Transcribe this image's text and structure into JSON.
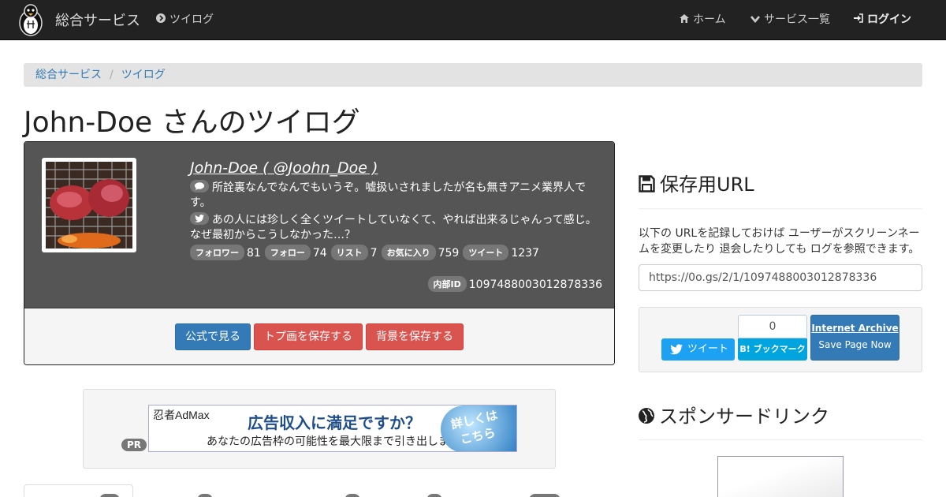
{
  "navbar": {
    "brand": "総合サービス",
    "tweet_log_link": "ツイログ",
    "home_link": "ホーム",
    "services_link": "サービス一覧",
    "login_link": "ログイン"
  },
  "breadcrumb": {
    "root": "総合サービス",
    "current": "ツイログ"
  },
  "page_title": "John-Doe さんのツイログ",
  "profile": {
    "name": "John-Doe ( @Joohn_Doe )",
    "bio": "所詮裏なんでなんでもいうぞ。嘘扱いされましたが名も無きアニメ業界人です。",
    "latest_tweet": "あの人には珍しく全くツイートしていなくて、やれば出来るじゃんって感じ。なぜ最初からこうしなかった…？",
    "stats": [
      {
        "label": "フォロワー",
        "value": "81"
      },
      {
        "label": "フォロー",
        "value": "74"
      },
      {
        "label": "リスト",
        "value": "7"
      },
      {
        "label": "お気に入り",
        "value": "759"
      },
      {
        "label": "ツイート",
        "value": "1237"
      }
    ],
    "inner_id_label": "内部ID",
    "inner_id": "1097488003012878336"
  },
  "actions": {
    "official": "公式で見る",
    "save_header": "トプ画を保存する",
    "save_background": "背景を保存する"
  },
  "ad": {
    "pr": "PR",
    "brand": "忍者AdMax",
    "headline": "広告収入に満足ですか？",
    "sub": "あなたの広告枠の可能性を最大限まで引き出します",
    "cta": "詳しくはこちら"
  },
  "sidebar": {
    "save_url_title": "保存用URL",
    "save_url_desc": "以下の URLを記録しておけば ユーザーがスクリーンネームを変更したり 退会したりしても ログを参照できます。",
    "save_url_value": "https://0o.gs/2/1/1097488003012878336",
    "tweet_button": "ツイート",
    "hatena_count": "0",
    "hatena_button": "B! ブックマーク",
    "archive_title": "Internet Archive",
    "archive_sub": "Save Page Now",
    "sponsor_title": "スポンサードリンク"
  },
  "colors": {
    "navbar": "#222222",
    "primary": "#337ab7",
    "danger": "#d9534f",
    "twitter": "#1da1f2",
    "hatena": "#00a4de"
  }
}
